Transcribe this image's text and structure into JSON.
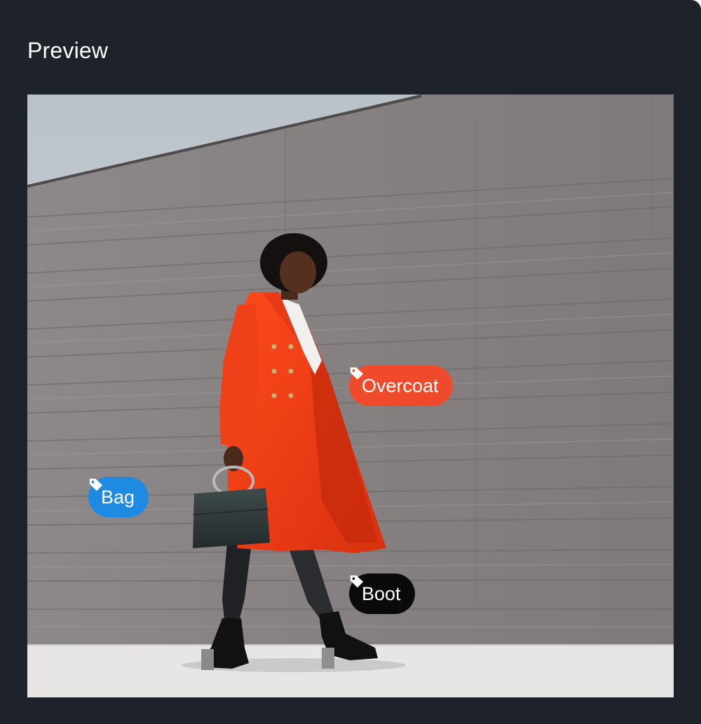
{
  "panel": {
    "title": "Preview",
    "background": "#1e222b"
  },
  "preview": {
    "tags": [
      {
        "label": "Overcoat",
        "icon": "tag-icon",
        "color": "#f04a2c"
      },
      {
        "label": "Bag",
        "icon": "tag-icon",
        "color": "#1f8ae2"
      },
      {
        "label": "Boot",
        "icon": "tag-icon",
        "color": "#0a0a0a"
      }
    ]
  }
}
